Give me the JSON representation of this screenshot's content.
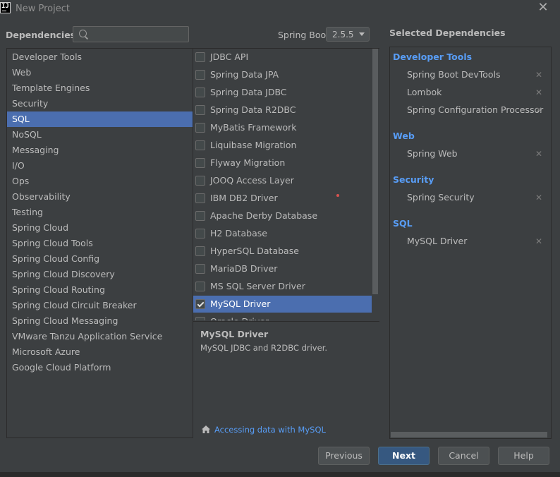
{
  "window": {
    "title": "New Project",
    "logo_text": "IJ"
  },
  "header": {
    "dependencies_label": "Dependencies",
    "search": {
      "value": "",
      "placeholder": ""
    },
    "spring_boot_label": "Spring Boot",
    "spring_boot_version": "2.5.5",
    "selected_dependencies_label": "Selected Dependencies"
  },
  "categories": [
    {
      "label": "Developer Tools"
    },
    {
      "label": "Web"
    },
    {
      "label": "Template Engines"
    },
    {
      "label": "Security"
    },
    {
      "label": "SQL",
      "selected": true
    },
    {
      "label": "NoSQL"
    },
    {
      "label": "Messaging"
    },
    {
      "label": "I/O"
    },
    {
      "label": "Ops"
    },
    {
      "label": "Observability"
    },
    {
      "label": "Testing"
    },
    {
      "label": "Spring Cloud"
    },
    {
      "label": "Spring Cloud Tools"
    },
    {
      "label": "Spring Cloud Config"
    },
    {
      "label": "Spring Cloud Discovery"
    },
    {
      "label": "Spring Cloud Routing"
    },
    {
      "label": "Spring Cloud Circuit Breaker"
    },
    {
      "label": "Spring Cloud Messaging"
    },
    {
      "label": "VMware Tanzu Application Service"
    },
    {
      "label": "Microsoft Azure"
    },
    {
      "label": "Google Cloud Platform"
    }
  ],
  "dependencies": [
    {
      "label": "JDBC API",
      "checked": false
    },
    {
      "label": "Spring Data JPA",
      "checked": false
    },
    {
      "label": "Spring Data JDBC",
      "checked": false
    },
    {
      "label": "Spring Data R2DBC",
      "checked": false
    },
    {
      "label": "MyBatis Framework",
      "checked": false
    },
    {
      "label": "Liquibase Migration",
      "checked": false
    },
    {
      "label": "Flyway Migration",
      "checked": false
    },
    {
      "label": "JOOQ Access Layer",
      "checked": false
    },
    {
      "label": "IBM DB2 Driver",
      "checked": false
    },
    {
      "label": "Apache Derby Database",
      "checked": false
    },
    {
      "label": "H2 Database",
      "checked": false
    },
    {
      "label": "HyperSQL Database",
      "checked": false
    },
    {
      "label": "MariaDB Driver",
      "checked": false
    },
    {
      "label": "MS SQL Server Driver",
      "checked": false
    },
    {
      "label": "MySQL Driver",
      "checked": true,
      "selected": true
    },
    {
      "label": "Oracle Driver",
      "checked": false
    }
  ],
  "description": {
    "title": "MySQL Driver",
    "text": "MySQL JDBC and R2DBC driver.",
    "guide_link": "Accessing data with MySQL"
  },
  "selected": [
    {
      "group": "Developer Tools",
      "items": [
        "Spring Boot DevTools",
        "Lombok",
        "Spring Configuration Processor"
      ]
    },
    {
      "group": "Web",
      "items": [
        "Spring Web"
      ]
    },
    {
      "group": "Security",
      "items": [
        "Spring Security"
      ]
    },
    {
      "group": "SQL",
      "items": [
        "MySQL Driver"
      ]
    }
  ],
  "remove_glyph": "✕",
  "buttons": {
    "previous": "Previous",
    "next": "Next",
    "cancel": "Cancel",
    "help": "Help"
  },
  "colors": {
    "background": "#3c3f41",
    "selection": "#4b6eaf",
    "link": "#589df6",
    "default_button": "#365880"
  }
}
